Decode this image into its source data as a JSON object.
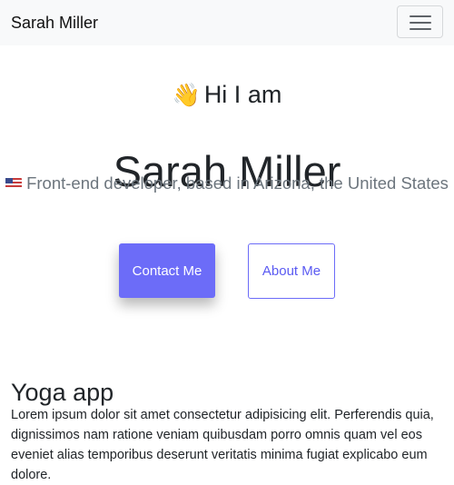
{
  "navbar": {
    "brand": "Sarah Miller",
    "toggler_icon": "hamburger-icon"
  },
  "hero": {
    "wave_icon": "👋",
    "greeting": "Hi I am",
    "name": "Sarah Miller",
    "flag_icon": "us-flag-icon",
    "tagline": "Front-end developer, based in Arizona, the United States"
  },
  "actions": {
    "contact_label": "Contact Me",
    "about_label": "About Me"
  },
  "project": {
    "title": "Yoga app",
    "description": "Lorem ipsum dolor sit amet consectetur adipisicing elit. Perferendis quia, dignissimos nam ratione veniam quibusdam porro omnis quam vel eos eveniet alias temporibus deserunt veritatis minima fugiat explicabo eum dolore."
  },
  "colors": {
    "accent": "#6c6cf8",
    "navbar_bg": "#f8f9fa",
    "muted_text": "#6c757d"
  }
}
